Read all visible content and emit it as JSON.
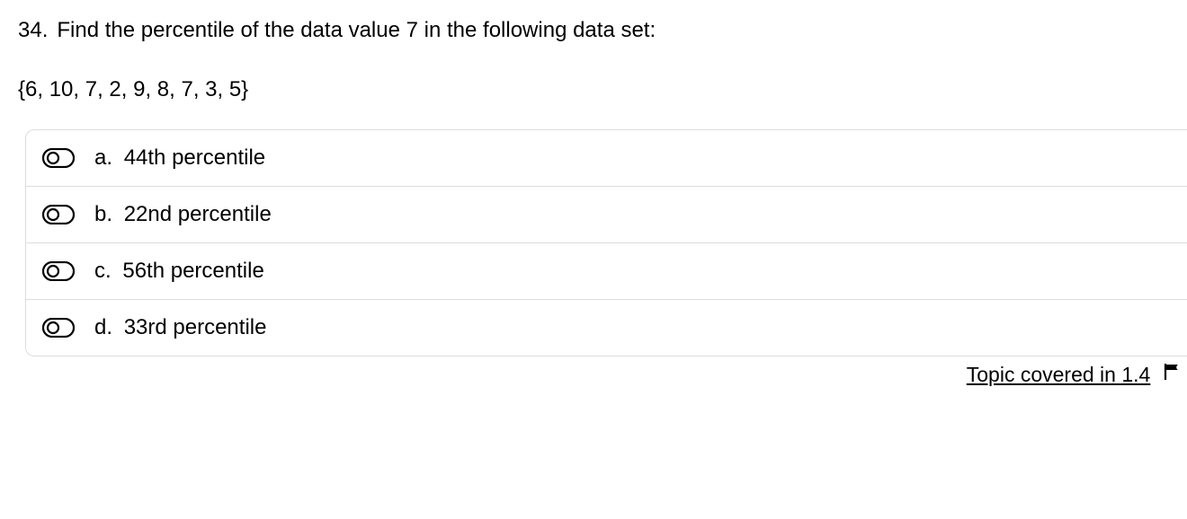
{
  "question": {
    "number": "34.",
    "text": "Find the percentile of the data value 7 in the following data set:",
    "dataset": "{6, 10, 7, 2, 9, 8, 7, 3, 5}"
  },
  "options": [
    {
      "letter": "a.",
      "text": "44th percentile"
    },
    {
      "letter": "b.",
      "text": "22nd percentile"
    },
    {
      "letter": "c.",
      "text": "56th percentile"
    },
    {
      "letter": "d.",
      "text": "33rd percentile"
    }
  ],
  "footer": {
    "link": "Topic covered in 1.4"
  }
}
